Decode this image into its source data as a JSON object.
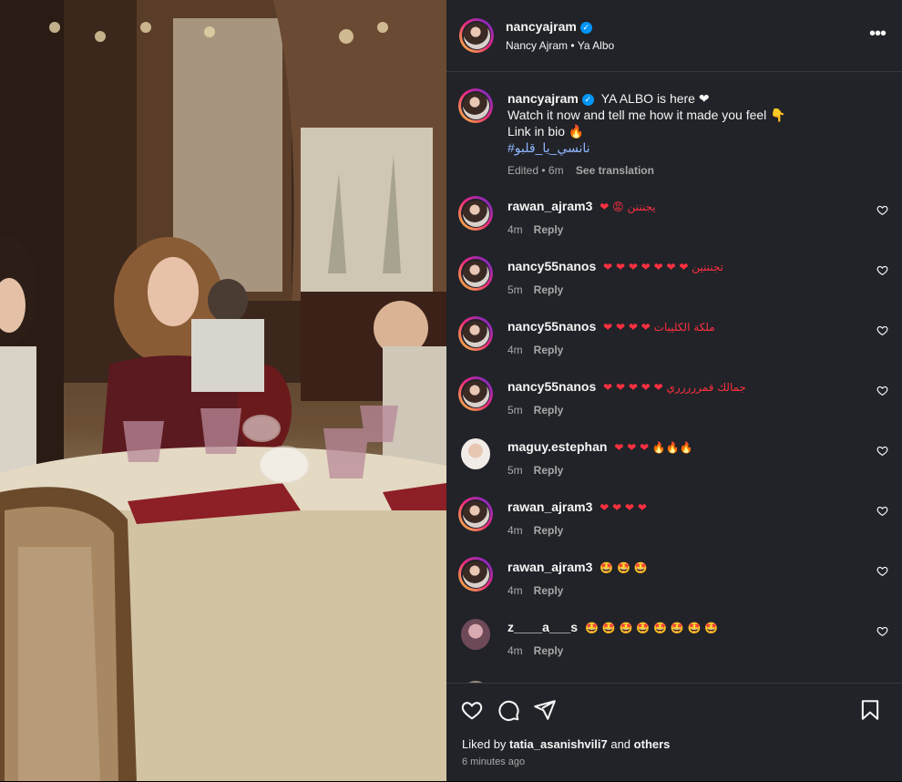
{
  "post": {
    "username": "nancyajram",
    "subtitle": "Nancy Ajram",
    "audio": "Ya Albo",
    "caption": {
      "username": "nancyajram",
      "line1": "YA ALBO is here ❤",
      "line2": "Watch it now and tell me how it made you feel 👇",
      "line3": "Link in bio 🔥",
      "hashtag": "#نانسي_يا_قلبو",
      "edited": "Edited • 6m",
      "see_translation": "See translation"
    }
  },
  "comments": [
    {
      "username": "rawan_ajram3",
      "text": "❤ 😡 يجنننن",
      "time": "4m",
      "reply": "Reply"
    },
    {
      "username": "nancy55nanos",
      "text": "❤ ❤ ❤ ❤ ❤ ❤ ❤ تجنننين",
      "time": "5m",
      "reply": "Reply"
    },
    {
      "username": "nancy55nanos",
      "text": "❤ ❤ ❤ ❤ ملكة الكليبات",
      "time": "4m",
      "reply": "Reply"
    },
    {
      "username": "nancy55nanos",
      "text": "❤ ❤ ❤ ❤ ❤ جمالك قمررررري",
      "time": "5m",
      "reply": "Reply"
    },
    {
      "username": "maguy.estephan",
      "text": "❤ ❤ ❤ 🔥🔥🔥",
      "time": "5m",
      "reply": "Reply"
    },
    {
      "username": "rawan_ajram3",
      "text": "❤ ❤ ❤ ❤",
      "time": "4m",
      "reply": "Reply"
    },
    {
      "username": "rawan_ajram3",
      "text": "🤩 🤩 🤩",
      "time": "4m",
      "reply": "Reply"
    },
    {
      "username": "z____a___s",
      "text": "🤩 🤩 🤩 🤩 🤩 🤩 🤩 🤩",
      "time": "4m",
      "reply": "Reply"
    }
  ],
  "footer": {
    "liked_by_prefix": "Liked by",
    "liked_by_user": "tatia_asanishvili7",
    "liked_by_and": "and",
    "liked_by_others": "others",
    "time": "6 minutes ago"
  },
  "icons": {
    "like": "heart-icon",
    "comment": "comment-icon",
    "share": "share-icon",
    "save": "bookmark-icon",
    "more": "more-icon",
    "verified": "verified-icon"
  },
  "colors": {
    "panel_bg": "#212328",
    "verified": "#0095f6",
    "muted_text": "#a8a8a8"
  }
}
